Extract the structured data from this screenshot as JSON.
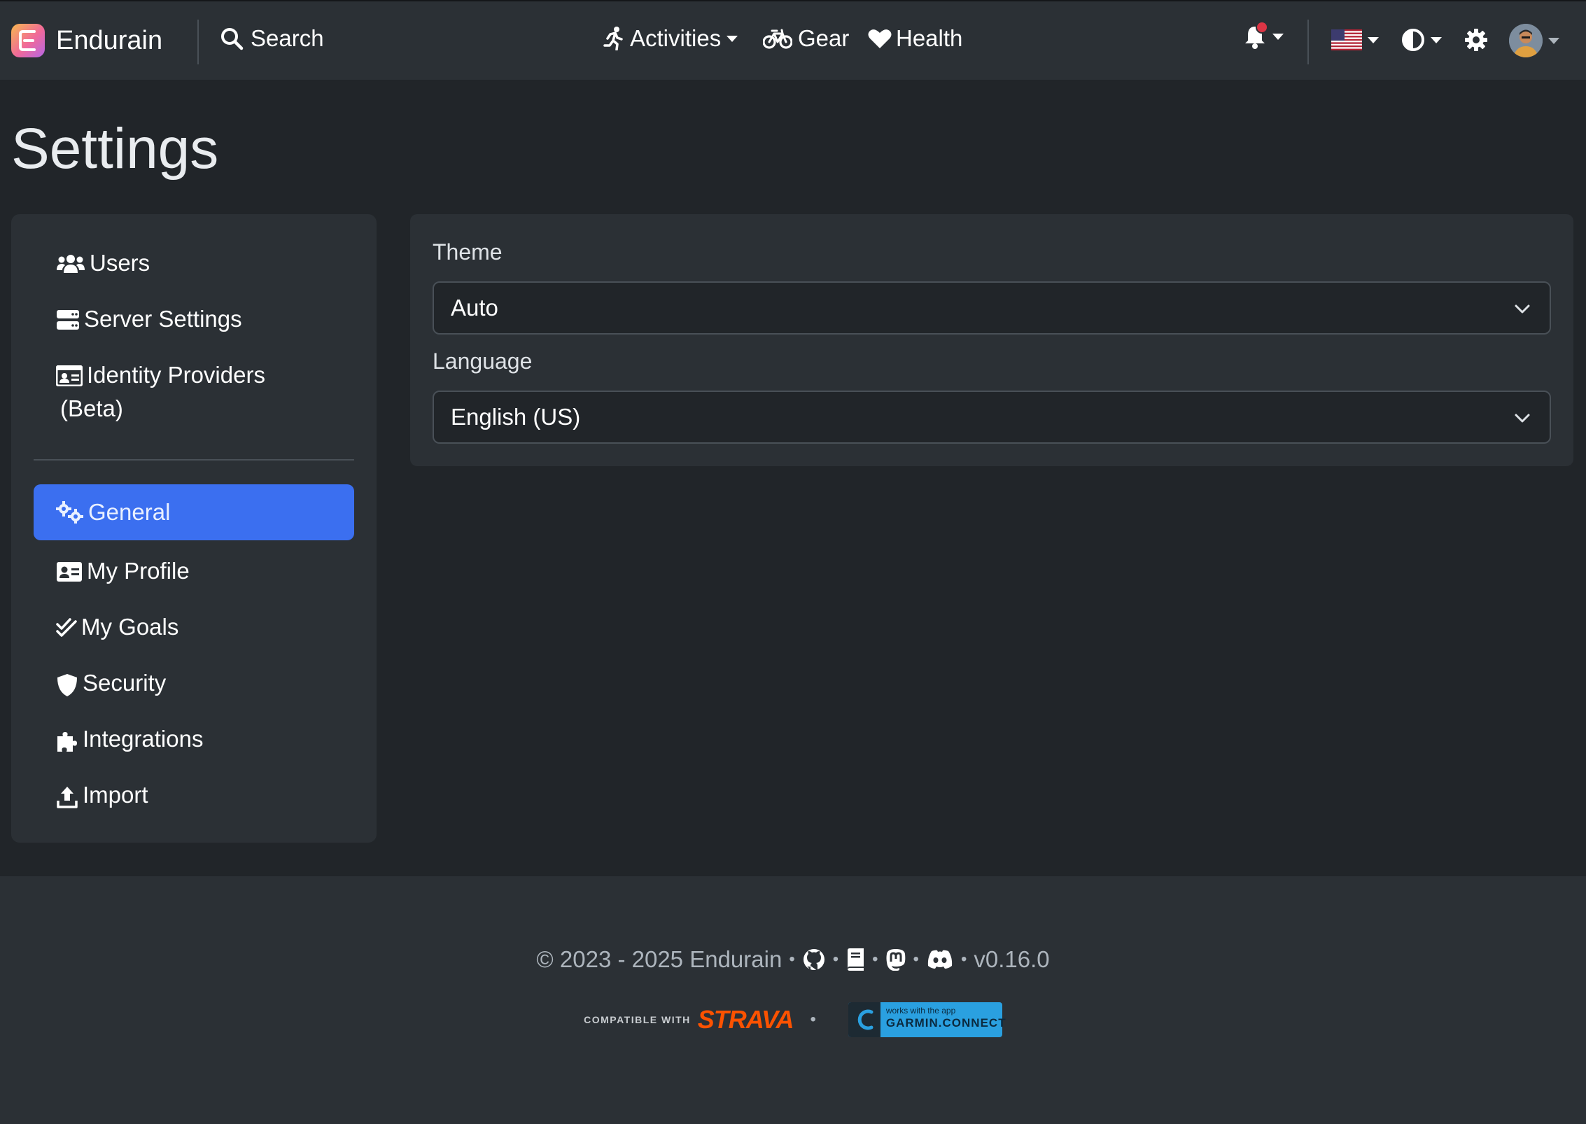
{
  "navbar": {
    "brand": "Endurain",
    "search_label": "Search",
    "activities_label": "Activities",
    "gear_label": "Gear",
    "health_label": "Health",
    "notification_badge_color": "#dc3545",
    "icons": [
      "bell-icon",
      "us-flag-icon",
      "theme-contrast-icon",
      "gear-icon",
      "avatar"
    ]
  },
  "page": {
    "title": "Settings"
  },
  "sidebar": {
    "items": [
      {
        "label": "Users",
        "icon": "users-icon"
      },
      {
        "label": "Server Settings",
        "icon": "server-icon"
      },
      {
        "label": "Identity Providers",
        "label2": "(Beta)",
        "icon": "id-card-icon"
      },
      {
        "label": "General",
        "icon": "gears-icon",
        "active": true
      },
      {
        "label": "My Profile",
        "icon": "id-card-icon"
      },
      {
        "label": "My Goals",
        "icon": "check-double-icon"
      },
      {
        "label": "Security",
        "icon": "shield-icon"
      },
      {
        "label": "Integrations",
        "icon": "puzzle-icon"
      },
      {
        "label": "Import",
        "icon": "upload-icon"
      }
    ],
    "active_color": "#3b6ff0"
  },
  "main": {
    "theme": {
      "label": "Theme",
      "value": "Auto"
    },
    "language": {
      "label": "Language",
      "value": "English (US)"
    }
  },
  "footer": {
    "copyright": "© 2023 - 2025 Endurain",
    "version": "v0.16.0",
    "compat_text": "COMPATIBLE WITH",
    "strava_text": "STRAVA",
    "garmin_small": "works with the app",
    "garmin_big": "GARMIN.CONNECT",
    "strava_color": "#fc5200",
    "garmin_color": "#2aa0e0"
  }
}
